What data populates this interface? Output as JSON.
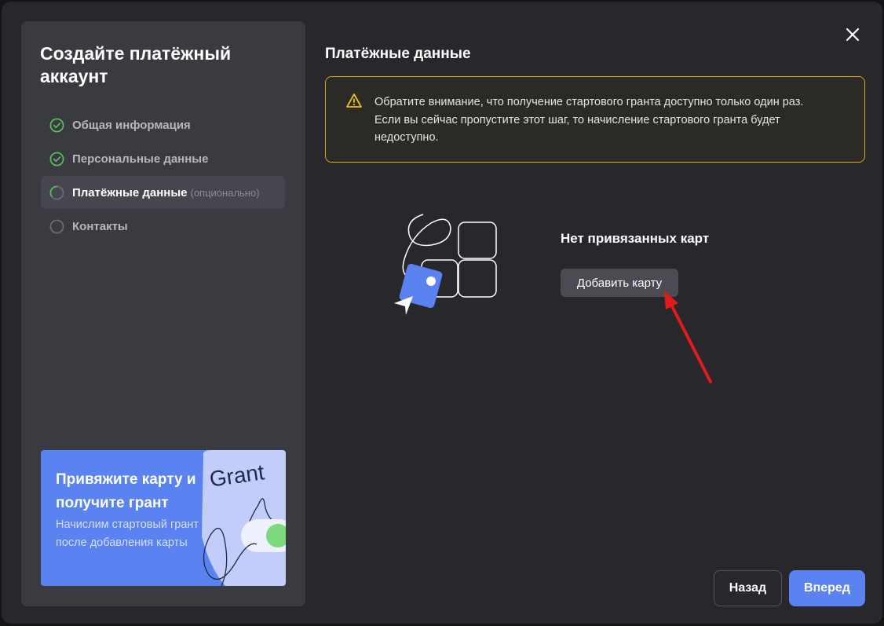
{
  "sidebar": {
    "title": "Создайте платёжный аккаунт",
    "steps": [
      {
        "label": "Общая информация",
        "status": "done"
      },
      {
        "label": "Персональные данные",
        "status": "done"
      },
      {
        "label": "Платёжные данные",
        "optional": "(опционально)",
        "status": "current"
      },
      {
        "label": "Контакты",
        "status": "pending"
      }
    ],
    "promo": {
      "title": "Привяжите карту и получите грант",
      "text": "Начислим стартовый грант после добавления карты",
      "grant_word": "Grant"
    }
  },
  "main": {
    "title": "Платёжные данные",
    "alert": {
      "icon": "warning-icon",
      "text": "Обратите внимание, что получение стартового гранта доступно только один раз. Если вы сейчас пропустите этот шаг, то начисление стартового гранта будет недоступно."
    },
    "empty_state": {
      "title": "Нет привязанных карт",
      "add_button": "Добавить карту"
    }
  },
  "footer": {
    "back_label": "Назад",
    "next_label": "Вперед"
  },
  "colors": {
    "accent": "#5a82f0",
    "success": "#5cc05a",
    "warning": "#d6a71c",
    "annotation": "#e01b1b"
  }
}
